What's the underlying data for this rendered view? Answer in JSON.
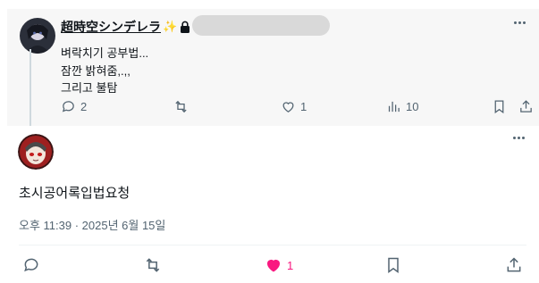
{
  "parent_post": {
    "display_name": "超時空シンデレラ",
    "lines": [
      "벼락치기 공부법...",
      "잠깐 밝혀줌,.,,",
      "그리고 불탐"
    ],
    "reply_count": "2",
    "like_count": "1",
    "view_count": "10"
  },
  "main_post": {
    "text": "초시공어록입법요청",
    "timestamp": "오후 11:39 · 2025년 6월 15일",
    "like_count": "1"
  },
  "colors": {
    "accent_like": "#f91880",
    "muted": "#536471",
    "parent_background": "#f7f7f7"
  },
  "icons": [
    "reply-icon",
    "retweet-icon",
    "heart-icon",
    "analytics-icon",
    "bookmark-icon",
    "share-icon",
    "more-icon",
    "lock-icon",
    "sparkles-icon"
  ]
}
